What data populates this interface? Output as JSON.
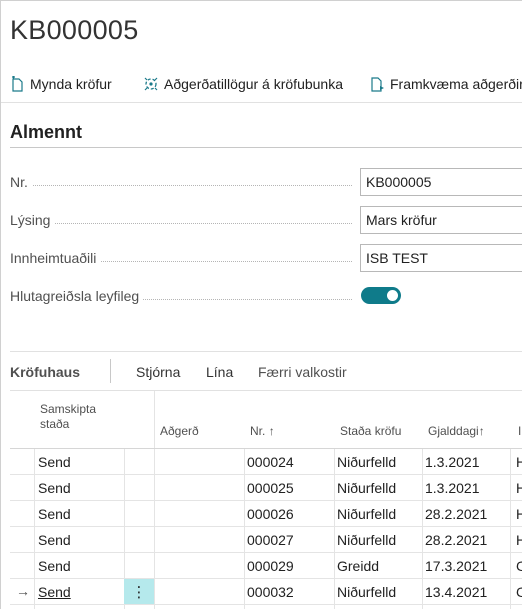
{
  "page": {
    "title": "KB000005"
  },
  "actions": [
    {
      "label": "Mynda kröfur",
      "icon": "create-document-icon"
    },
    {
      "label": "Aðgerðatillögur á kröfubunka",
      "icon": "suggest-actions-icon"
    },
    {
      "label": "Framkvæma aðgerðir",
      "icon": "execute-document-icon"
    }
  ],
  "general": {
    "title": "Almennt",
    "fields": [
      {
        "label": "Nr.",
        "value": "KB000005"
      },
      {
        "label": "Lýsing",
        "value": "Mars kröfur"
      },
      {
        "label": "Innheimtuaðili",
        "value": "ISB TEST"
      },
      {
        "label": "Hlutagreiðsla leyfileg",
        "value": true
      }
    ]
  },
  "subpage": {
    "title": "Kröfuhaus",
    "tabs": [
      "Stjórna",
      "Lína",
      "Færri valkostir"
    ]
  },
  "grid": {
    "columns": {
      "status_line1": "Samskipta",
      "status_line2": "staða",
      "action": "Aðgerð",
      "no": "Nr.",
      "no_sort": "↑",
      "claim_status": "Staða kröfu",
      "due_date": "Gjalddagi",
      "due_sort": "↑",
      "next": "I"
    },
    "rows": [
      {
        "status": "Send",
        "action": "",
        "no": "000024",
        "claim_status": "Niðurfelld",
        "due_date": "1.3.2021",
        "next": "H"
      },
      {
        "status": "Send",
        "action": "",
        "no": "000025",
        "claim_status": "Niðurfelld",
        "due_date": "1.3.2021",
        "next": "H"
      },
      {
        "status": "Send",
        "action": "",
        "no": "000026",
        "claim_status": "Niðurfelld",
        "due_date": "28.2.2021",
        "next": "H"
      },
      {
        "status": "Send",
        "action": "",
        "no": "000027",
        "claim_status": "Niðurfelld",
        "due_date": "28.2.2021",
        "next": "H"
      },
      {
        "status": "Send",
        "action": "",
        "no": "000029",
        "claim_status": "Greidd",
        "due_date": "17.3.2021",
        "next": "C"
      },
      {
        "status": "Send",
        "action": "",
        "no": "000032",
        "claim_status": "Niðurfelld",
        "due_date": "13.4.2021",
        "next": "C"
      }
    ],
    "active_marker": "→",
    "row_menu_glyph": "⋮"
  },
  "colors": {
    "accent": "#0f7b8a",
    "selected_cell": "#b5e9ec"
  }
}
